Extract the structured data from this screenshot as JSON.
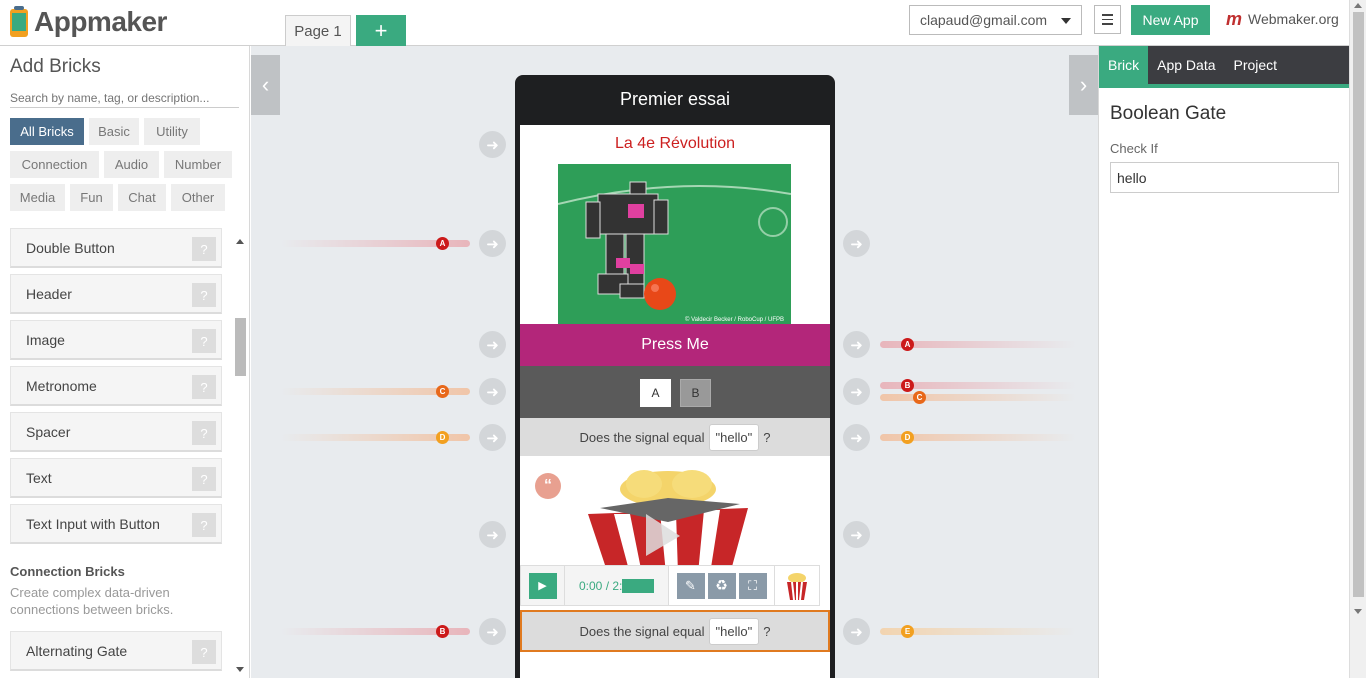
{
  "app": {
    "logo_text": "Appmaker"
  },
  "topbar": {
    "page_tab": "Page 1",
    "add_page": "+",
    "user_email": "clapaud@gmail.com",
    "new_app": "New App",
    "webmaker": "Webmaker.org",
    "webmaker_mark": "m"
  },
  "sidebar": {
    "title": "Add Bricks",
    "search_placeholder": "Search by name, tag, or description...",
    "tags": [
      "All Bricks",
      "Basic",
      "Utility",
      "Connection",
      "Audio",
      "Number",
      "Media",
      "Fun",
      "Chat",
      "Other"
    ],
    "bricks": [
      "Double Button",
      "Header",
      "Image",
      "Metronome",
      "Spacer",
      "Text",
      "Text Input with Button"
    ],
    "help": "?",
    "section_title": "Connection Bricks",
    "section_desc": "Create complex data-driven connections between bricks.",
    "connection_bricks": [
      "Alternating Gate"
    ]
  },
  "phone": {
    "title": "Premier essai",
    "header_text": "La 4e Révolution",
    "image_credit": "© Valdecir Becker / RoboCup / UFPB",
    "press_button": "Press Me",
    "double_a": "A",
    "double_b": "B",
    "gate_prefix": "Does the signal equal",
    "gate_value": "\"hello\"",
    "gate_suffix": "?",
    "popcorn_time": "0:00 / 2:",
    "quote_icon": "“"
  },
  "canvas": {
    "left_channels": [
      "A",
      "C",
      "D",
      "B"
    ],
    "right_channels": [
      "A",
      "B",
      "C",
      "D",
      "E"
    ]
  },
  "rpanel": {
    "tabs": [
      "Brick",
      "App Data",
      "Project"
    ],
    "title": "Boolean Gate",
    "field_label": "Check If",
    "field_value": "hello"
  },
  "colors": {
    "accent": "#3aaa80",
    "press": "#b3267a",
    "active_tag": "#4a6d8c",
    "channel_red": "#cc1a1a",
    "channel_orange": "#e8681a",
    "channel_yellow": "#f2a020"
  }
}
